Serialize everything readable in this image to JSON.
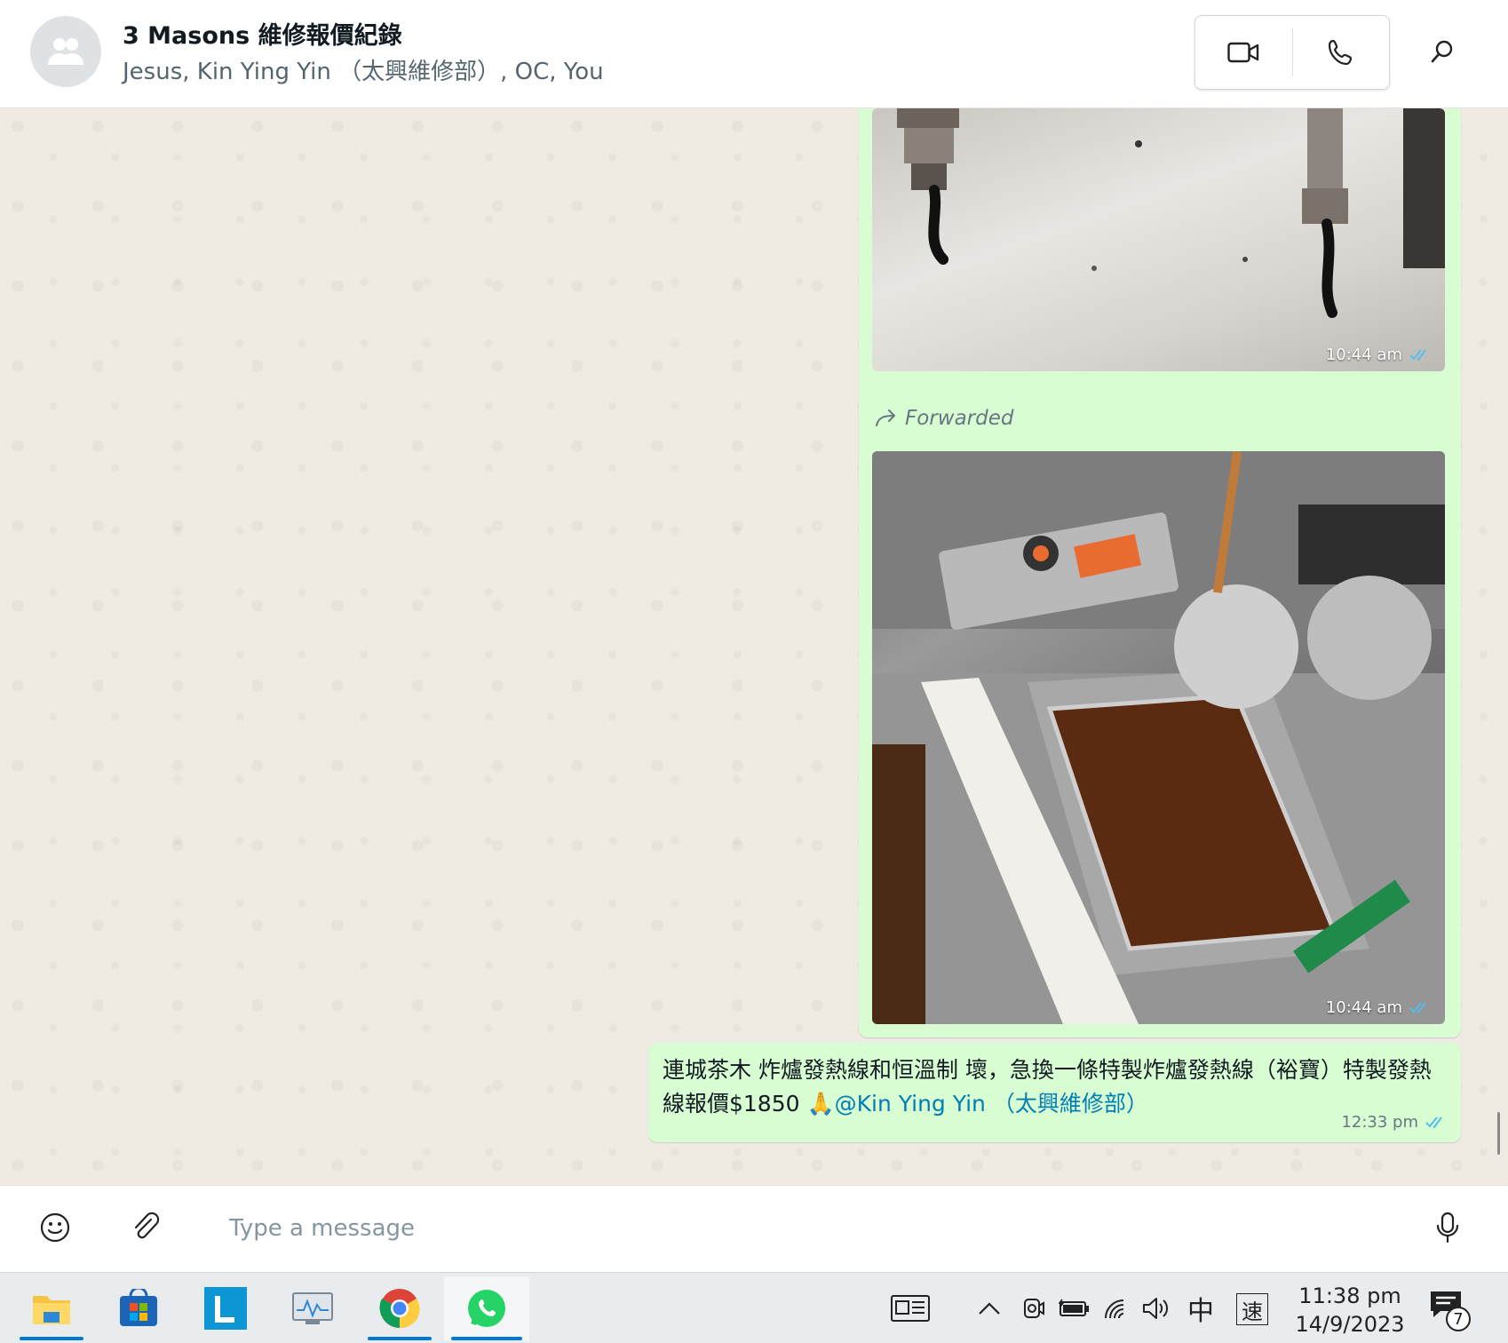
{
  "header": {
    "title": "3 Masons 維修報價紀錄",
    "participants": "Jesus, Kin Ying Yin （太興維修部）, OC, You"
  },
  "messages": [
    {
      "type": "image",
      "time": "10:44 am"
    },
    {
      "type": "image",
      "forwarded_label": "Forwarded",
      "time": "10:44 am"
    },
    {
      "type": "text",
      "text": "連城茶木 炸爐發熱線和恒溫制 壞，急換一條特製炸爐發熱線（裕寶）特製發熱線報價$1850 🙏",
      "mention": "@Kin Ying Yin （太興維修部）",
      "time": "12:33 pm"
    }
  ],
  "composer": {
    "placeholder": "Type a message"
  },
  "taskbar": {
    "ime_mode": "中",
    "ime_speed": "速",
    "time": "11:38 pm",
    "date": "14/9/2023",
    "notification_count": "7"
  },
  "colors": {
    "bubble_out": "#d9fdd3",
    "read_tick": "#53bdeb",
    "accent": "#0078d4",
    "whatsapp_green": "#25d366"
  }
}
